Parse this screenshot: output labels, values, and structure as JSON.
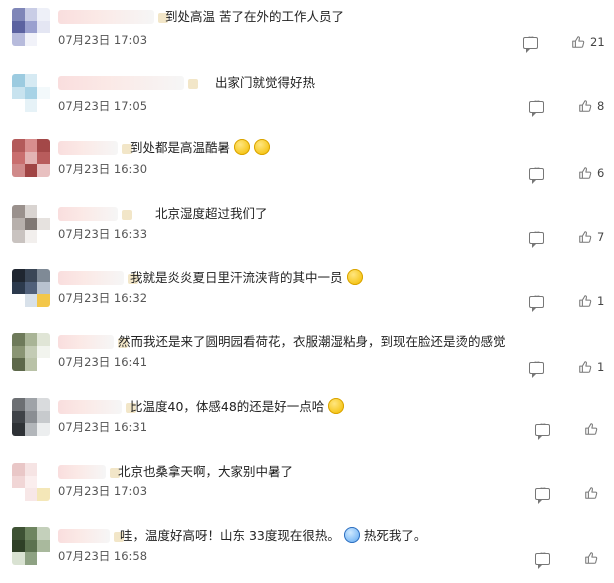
{
  "comments": [
    {
      "text": "到处高温 苦了在外的工作人员了",
      "emojis": [],
      "time": "07月23日 17:03",
      "likes": "21"
    },
    {
      "text": "出家门就觉得好热",
      "emojis": [],
      "time": "07月23日 17:05",
      "likes": "8"
    },
    {
      "text": "到处都是高温酷暑",
      "emojis": [
        "emoji-smile",
        "emoji-smile"
      ],
      "time": "07月23日 16:30",
      "likes": "6"
    },
    {
      "text": "北京湿度超过我们了",
      "emojis": [],
      "time": "07月23日 16:33",
      "likes": "7"
    },
    {
      "text": "我就是炎炎夏日里汗流浃背的其中一员",
      "emojis": [
        "emoji-smile"
      ],
      "time": "07月23日 16:32",
      "likes": "1"
    },
    {
      "text": "然而我还是来了圆明园看荷花，衣服潮湿粘身，到现在脸还是烫的感觉",
      "emojis": [],
      "time": "07月23日 16:41",
      "likes": "1"
    },
    {
      "text": "比温度40，体感48的还是好一点哈",
      "emojis": [
        "emoji-laugh"
      ],
      "time": "07月23日 16:31",
      "likes": ""
    },
    {
      "text": "北京也桑拿天啊，大家别中暑了",
      "emojis": [],
      "time": "07月23日 17:03",
      "likes": ""
    },
    {
      "text": "哇，温度好高呀！山东 33度现在很热。",
      "emojis": [
        "emoji-dizzy"
      ],
      "text_after": "热死我了。",
      "time": "07月23日 16:58",
      "likes": ""
    }
  ],
  "colors": {
    "avatars": [
      [
        "#7f86b8",
        "#c9cde6",
        "#eef0f8",
        "#5b62a0",
        "#9aa0cf",
        "#e4e6f3",
        "#b7bbdc",
        "#f1f2f9",
        "#ffffff"
      ],
      [
        "#9ccbe0",
        "#d6eaf3",
        "#ffffff",
        "#c8e3ef",
        "#a8d3e6",
        "#f3f9fb",
        "#ffffff",
        "#e6f2f7",
        "#ffffff"
      ],
      [
        "#b35a5a",
        "#d88e8e",
        "#a34848",
        "#c96e6e",
        "#e3b3b3",
        "#b85c5c",
        "#d08a8a",
        "#a04444",
        "#e8c0c0"
      ],
      [
        "#9a918d",
        "#d9d4d1",
        "#ffffff",
        "#b7b0ac",
        "#807874",
        "#e6e2df",
        "#c9c3c0",
        "#f2efed",
        "#ffffff"
      ],
      [
        "#1f2630",
        "#3a4656",
        "#7f8a96",
        "#2c3a4d",
        "#50607a",
        "#b8c2cf",
        "#ffffff",
        "#d8e1ea",
        "#f3c74a"
      ],
      [
        "#6e7a5a",
        "#a9b496",
        "#e0e5d6",
        "#8a9574",
        "#c3cbb4",
        "#f2f4ee",
        "#5d684a",
        "#b9c2a7",
        "#ffffff"
      ],
      [
        "#6c6f73",
        "#9fa3a8",
        "#d9dbdd",
        "#3f4348",
        "#8a8e93",
        "#c7cacd",
        "#2e3236",
        "#b2b6ba",
        "#eceeef"
      ],
      [
        "#e9c7c7",
        "#f6e4e4",
        "#ffffff",
        "#f1d6d6",
        "#fbeeee",
        "#ffffff",
        "#ffffff",
        "#f7e7e7",
        "#f4e7b8"
      ],
      [
        "#3e5234",
        "#6e8560",
        "#c4d0bb",
        "#2f4027",
        "#5c7250",
        "#a9b99d",
        "#d9e2d2",
        "#8ea283",
        "#ffffff"
      ]
    ]
  }
}
